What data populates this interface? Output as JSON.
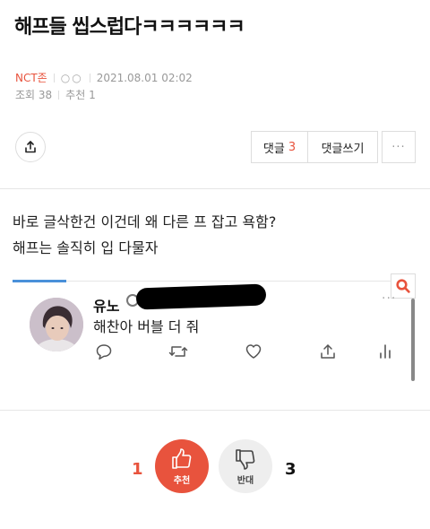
{
  "post": {
    "title": "해프들 씹스럽다ㅋㅋㅋㅋㅋㅋ",
    "category": "NCT존",
    "author": "○○",
    "datetime": "2021.08.01 02:02",
    "views_label": "조회 38",
    "recommend_label": "추천 1",
    "body_lines": [
      "바로 글삭한건 이건데 왜 다른 프 잡고 욕함?",
      "해프는 솔직히 입 다물자"
    ]
  },
  "toolbar": {
    "comment_label": "댓글",
    "comment_count": "3",
    "write_comment_label": "댓글쓰기",
    "more_label": "···"
  },
  "tweet": {
    "name": "유노",
    "more_label": "···",
    "text": "해찬아 버블 더 줘"
  },
  "vote": {
    "up_count": "1",
    "up_label": "추천",
    "down_label": "반대",
    "down_count": "3"
  },
  "colors": {
    "accent": "#e8533d",
    "link_blue": "#4a90d9"
  }
}
